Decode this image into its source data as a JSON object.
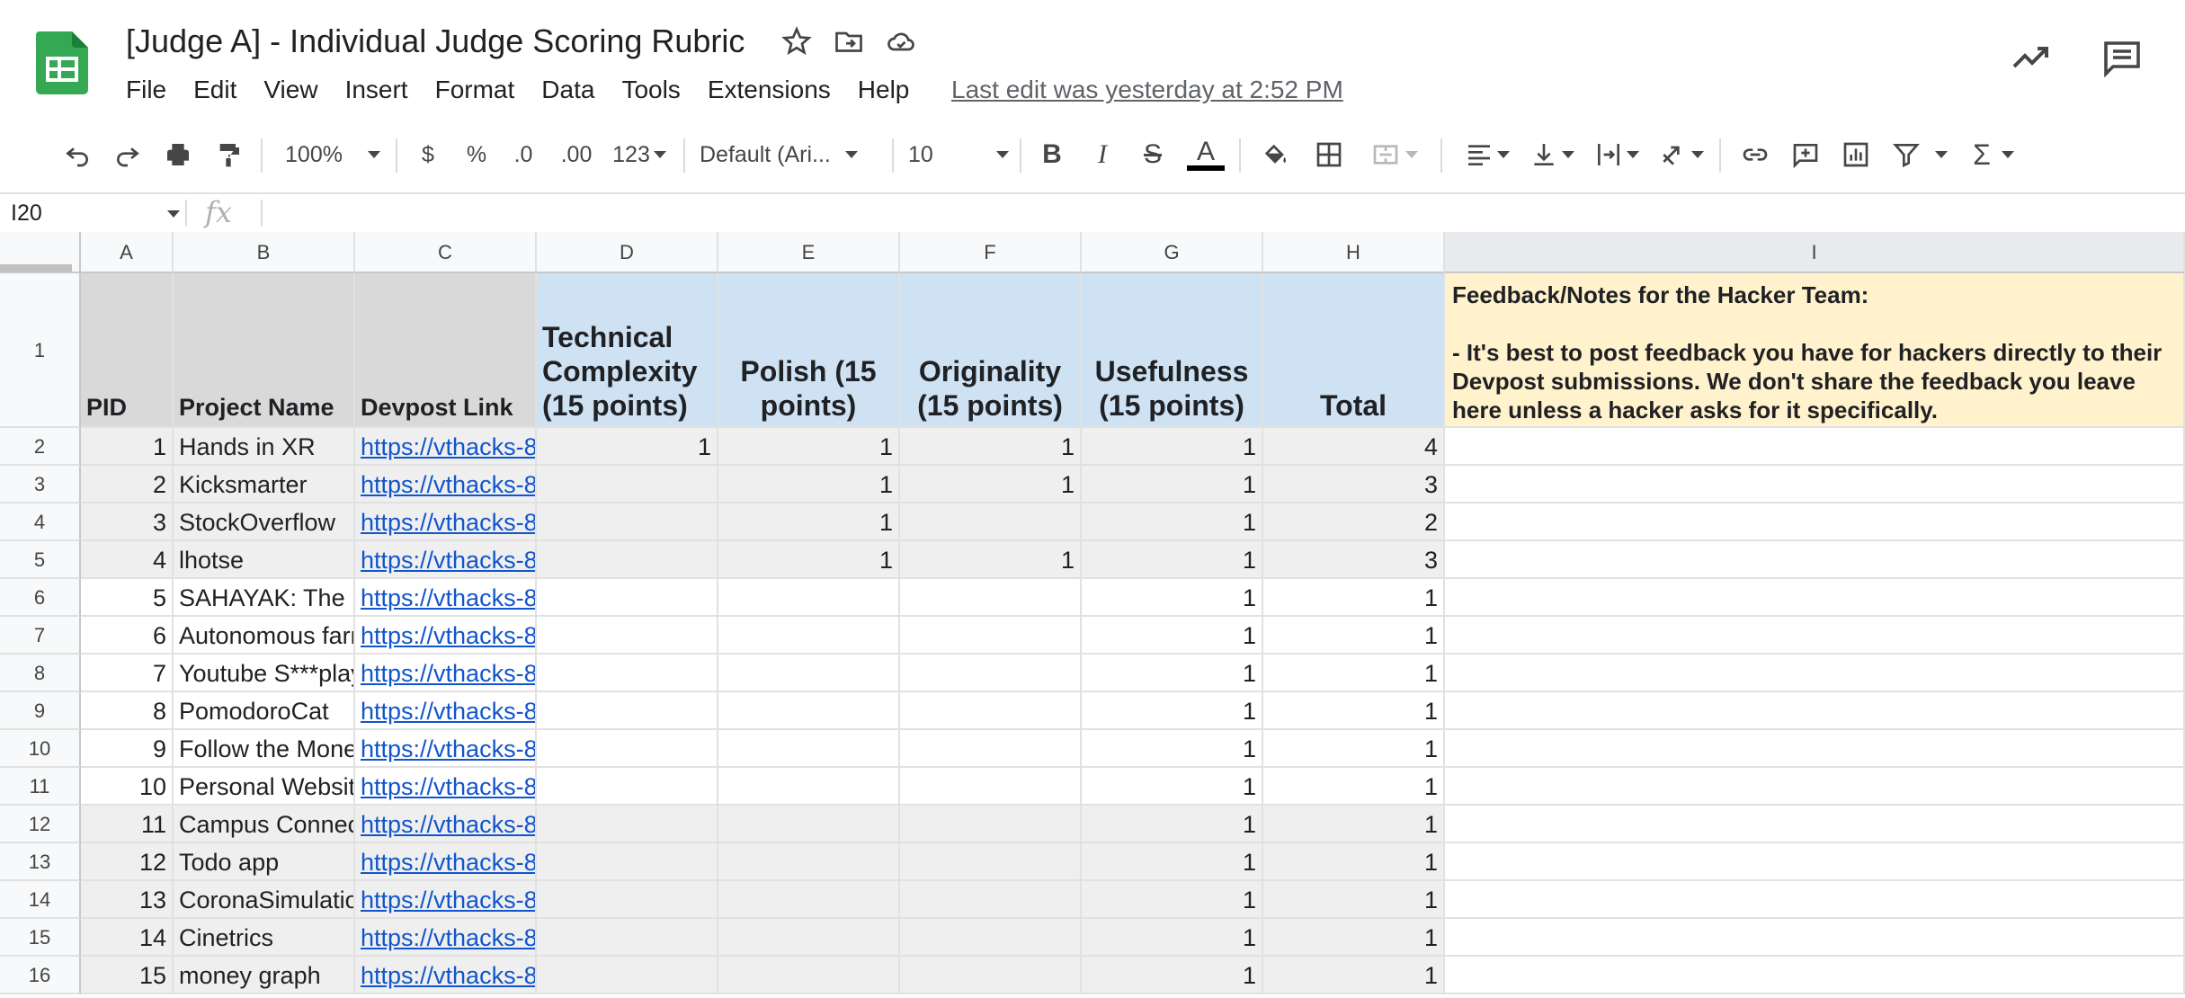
{
  "app": {
    "doc_title": "[Judge A] - Individual Judge Scoring Rubric",
    "menu": [
      "File",
      "Edit",
      "View",
      "Insert",
      "Format",
      "Data",
      "Tools",
      "Extensions",
      "Help"
    ],
    "last_edit": "Last edit was yesterday at 2:52 PM",
    "icons": [
      "sheets-logo-icon",
      "star-icon",
      "move-to-folder-icon",
      "cloud-status-icon",
      "activity-trend-icon",
      "comments-icon"
    ]
  },
  "toolbar": {
    "zoom": "100%",
    "currency": "$",
    "percent": "%",
    "decrease_decimal": ".0",
    "increase_decimal": ".00",
    "more_formats": "123",
    "font": "Default (Ari...",
    "font_size": "10",
    "bold": "B",
    "italic": "I",
    "strike": "S",
    "text_color": "A",
    "sum": "Σ"
  },
  "formula_bar": {
    "cell_ref": "I20",
    "fx": "fx",
    "value": ""
  },
  "columns": [
    "A",
    "B",
    "C",
    "D",
    "E",
    "F",
    "G",
    "H",
    "I"
  ],
  "selected_column": "I",
  "header_row": {
    "row_number": "1",
    "pid": "PID",
    "project_name": "Project Name",
    "devpost_link": "Devpost Link",
    "technical": "Technical Complexity (15 points)",
    "polish": "Polish (15 points)",
    "originality": "Originality (15 points)",
    "usefulness": "Usefulness (15 points)",
    "total": "Total",
    "notes_title": "Feedback/Notes for the Hacker Team:",
    "notes_body": "- It's best to post feedback you have for hackers directly to their Devpost submissions. We don't share the feedback you leave here unless a hacker asks for it specifically."
  },
  "rows": [
    {
      "row": "2",
      "pid": "1",
      "name": "Hands in XR",
      "link": "https://vthacks-8",
      "tech": "1",
      "polish": "1",
      "orig": "1",
      "use": "1",
      "total": "4",
      "shade": true
    },
    {
      "row": "3",
      "pid": "2",
      "name": "Kicksmarter",
      "link": "https://vthacks-8",
      "tech": "",
      "polish": "1",
      "orig": "1",
      "use": "1",
      "total": "3",
      "shade": true
    },
    {
      "row": "4",
      "pid": "3",
      "name": "StockOverflow",
      "link": "https://vthacks-8",
      "tech": "",
      "polish": "1",
      "orig": "",
      "use": "1",
      "total": "2",
      "shade": true
    },
    {
      "row": "5",
      "pid": "4",
      "name": "lhotse",
      "link": "https://vthacks-8",
      "tech": "",
      "polish": "1",
      "orig": "1",
      "use": "1",
      "total": "3",
      "shade": true
    },
    {
      "row": "6",
      "pid": "5",
      "name": "SAHAYAK: The I",
      "link": "https://vthacks-8",
      "tech": "",
      "polish": "",
      "orig": "",
      "use": "1",
      "total": "1",
      "shade": false
    },
    {
      "row": "7",
      "pid": "6",
      "name": "Autonomous farr",
      "link": "https://vthacks-8",
      "tech": "",
      "polish": "",
      "orig": "",
      "use": "1",
      "total": "1",
      "shade": false
    },
    {
      "row": "8",
      "pid": "7",
      "name": "Youtube S***play",
      "link": "https://vthacks-8",
      "tech": "",
      "polish": "",
      "orig": "",
      "use": "1",
      "total": "1",
      "shade": false
    },
    {
      "row": "9",
      "pid": "8",
      "name": "PomodoroCat",
      "link": "https://vthacks-8",
      "tech": "",
      "polish": "",
      "orig": "",
      "use": "1",
      "total": "1",
      "shade": false
    },
    {
      "row": "10",
      "pid": "9",
      "name": "Follow the Mone",
      "link": "https://vthacks-8",
      "tech": "",
      "polish": "",
      "orig": "",
      "use": "1",
      "total": "1",
      "shade": false
    },
    {
      "row": "11",
      "pid": "10",
      "name": "Personal Websit",
      "link": "https://vthacks-8",
      "tech": "",
      "polish": "",
      "orig": "",
      "use": "1",
      "total": "1",
      "shade": false
    },
    {
      "row": "12",
      "pid": "11",
      "name": "Campus Connec",
      "link": "https://vthacks-8",
      "tech": "",
      "polish": "",
      "orig": "",
      "use": "1",
      "total": "1",
      "shade": true
    },
    {
      "row": "13",
      "pid": "12",
      "name": "Todo app",
      "link": "https://vthacks-8",
      "tech": "",
      "polish": "",
      "orig": "",
      "use": "1",
      "total": "1",
      "shade": true
    },
    {
      "row": "14",
      "pid": "13",
      "name": "CoronaSimulatio",
      "link": "https://vthacks-8",
      "tech": "",
      "polish": "",
      "orig": "",
      "use": "1",
      "total": "1",
      "shade": true
    },
    {
      "row": "15",
      "pid": "14",
      "name": "Cinetrics",
      "link": "https://vthacks-8",
      "tech": "",
      "polish": "",
      "orig": "",
      "use": "1",
      "total": "1",
      "shade": true
    },
    {
      "row": "16",
      "pid": "15",
      "name": "money graph",
      "link": "https://vthacks-8",
      "tech": "",
      "polish": "",
      "orig": "",
      "use": "1",
      "total": "1",
      "shade": true
    }
  ],
  "colors": {
    "gray_header": "#d9d9d9",
    "shaded_row": "#efefef",
    "blue_header": "#cfe2f3",
    "notes_yellow": "#fff2cc",
    "link": "#1155cc",
    "sheets_green": "#34a853"
  }
}
